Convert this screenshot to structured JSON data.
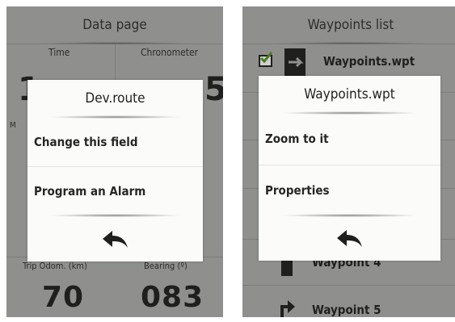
{
  "left": {
    "title": "Data page",
    "fields": {
      "time_label": "Time",
      "chrono_label": "Chronometer",
      "odom_label": "Trip Odom. (km)",
      "odom_value": "70",
      "bearing_label": "Bearing (º)",
      "bearing_value": "083"
    },
    "dialog": {
      "title": "Dev.route",
      "items": [
        "Change this field",
        "Program an Alarm"
      ],
      "back_icon": "back-arrow-icon"
    }
  },
  "right": {
    "title": "Waypoints list",
    "rows": {
      "file_label": "Waypoints.wpt",
      "wp4_label": "Waypoint 4",
      "wp5_label": "Waypoint 5"
    },
    "dialog": {
      "title": "Waypoints.wpt",
      "items": [
        "Zoom to it",
        "Properties"
      ],
      "back_icon": "back-arrow-icon"
    }
  },
  "colors": {
    "dim_background": "#8f908e",
    "dialog_background": "#fbfbf9",
    "text": "#1f201e"
  }
}
